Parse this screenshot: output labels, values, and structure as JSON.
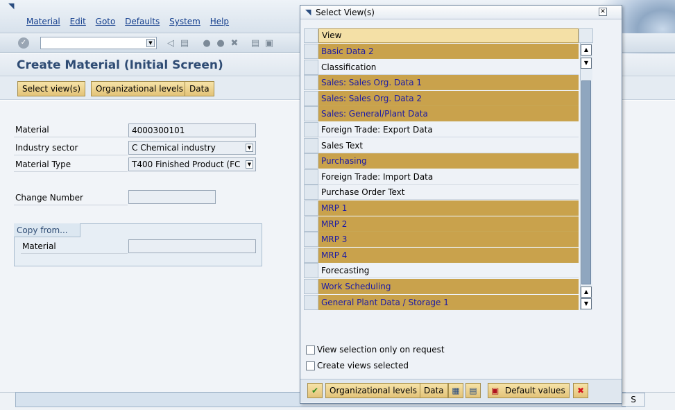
{
  "window": {
    "menu": [
      "Material",
      "Edit",
      "Goto",
      "Defaults",
      "System",
      "Help"
    ],
    "title": "Create Material (Initial Screen)",
    "app_buttons": [
      "Select view(s)",
      "Organizational levels",
      "Data"
    ]
  },
  "form": {
    "material_label": "Material",
    "material_value": "4000300101",
    "industry_label": "Industry sector",
    "industry_value": "C Chemical industry",
    "type_label": "Material Type",
    "type_value": "T400 Finished Product (FC",
    "change_label": "Change Number",
    "change_value": "",
    "copy_tab": "Copy from...",
    "copy_material_label": "Material",
    "copy_material_value": ""
  },
  "status": {
    "system": "S"
  },
  "dialog": {
    "title": "Select View(s)",
    "column_header": "View",
    "views": [
      {
        "label": "Basic Data 2",
        "selected": true
      },
      {
        "label": "Classification",
        "selected": false
      },
      {
        "label": "Sales: Sales Org. Data 1",
        "selected": true
      },
      {
        "label": "Sales: Sales Org. Data 2",
        "selected": true
      },
      {
        "label": "Sales: General/Plant Data",
        "selected": true
      },
      {
        "label": "Foreign Trade: Export Data",
        "selected": false
      },
      {
        "label": "Sales Text",
        "selected": false
      },
      {
        "label": "Purchasing",
        "selected": true
      },
      {
        "label": "Foreign Trade: Import Data",
        "selected": false
      },
      {
        "label": "Purchase Order Text",
        "selected": false
      },
      {
        "label": "MRP 1",
        "selected": true
      },
      {
        "label": "MRP 2",
        "selected": true
      },
      {
        "label": "MRP 3",
        "selected": true
      },
      {
        "label": "MRP 4",
        "selected": true
      },
      {
        "label": "Forecasting",
        "selected": false
      },
      {
        "label": "Work Scheduling",
        "selected": true
      },
      {
        "label": "General Plant Data / Storage 1",
        "selected": true
      }
    ],
    "option_view_on_request": "View selection only on request",
    "option_create_selected": "Create views selected",
    "footer_buttons": {
      "org_levels": "Organizational levels",
      "data": "Data",
      "default_values": "Default values"
    }
  },
  "colors": {
    "selected_row": "#c9a24c",
    "selected_text": "#1a1aa6",
    "accent": "#2f4c74"
  }
}
